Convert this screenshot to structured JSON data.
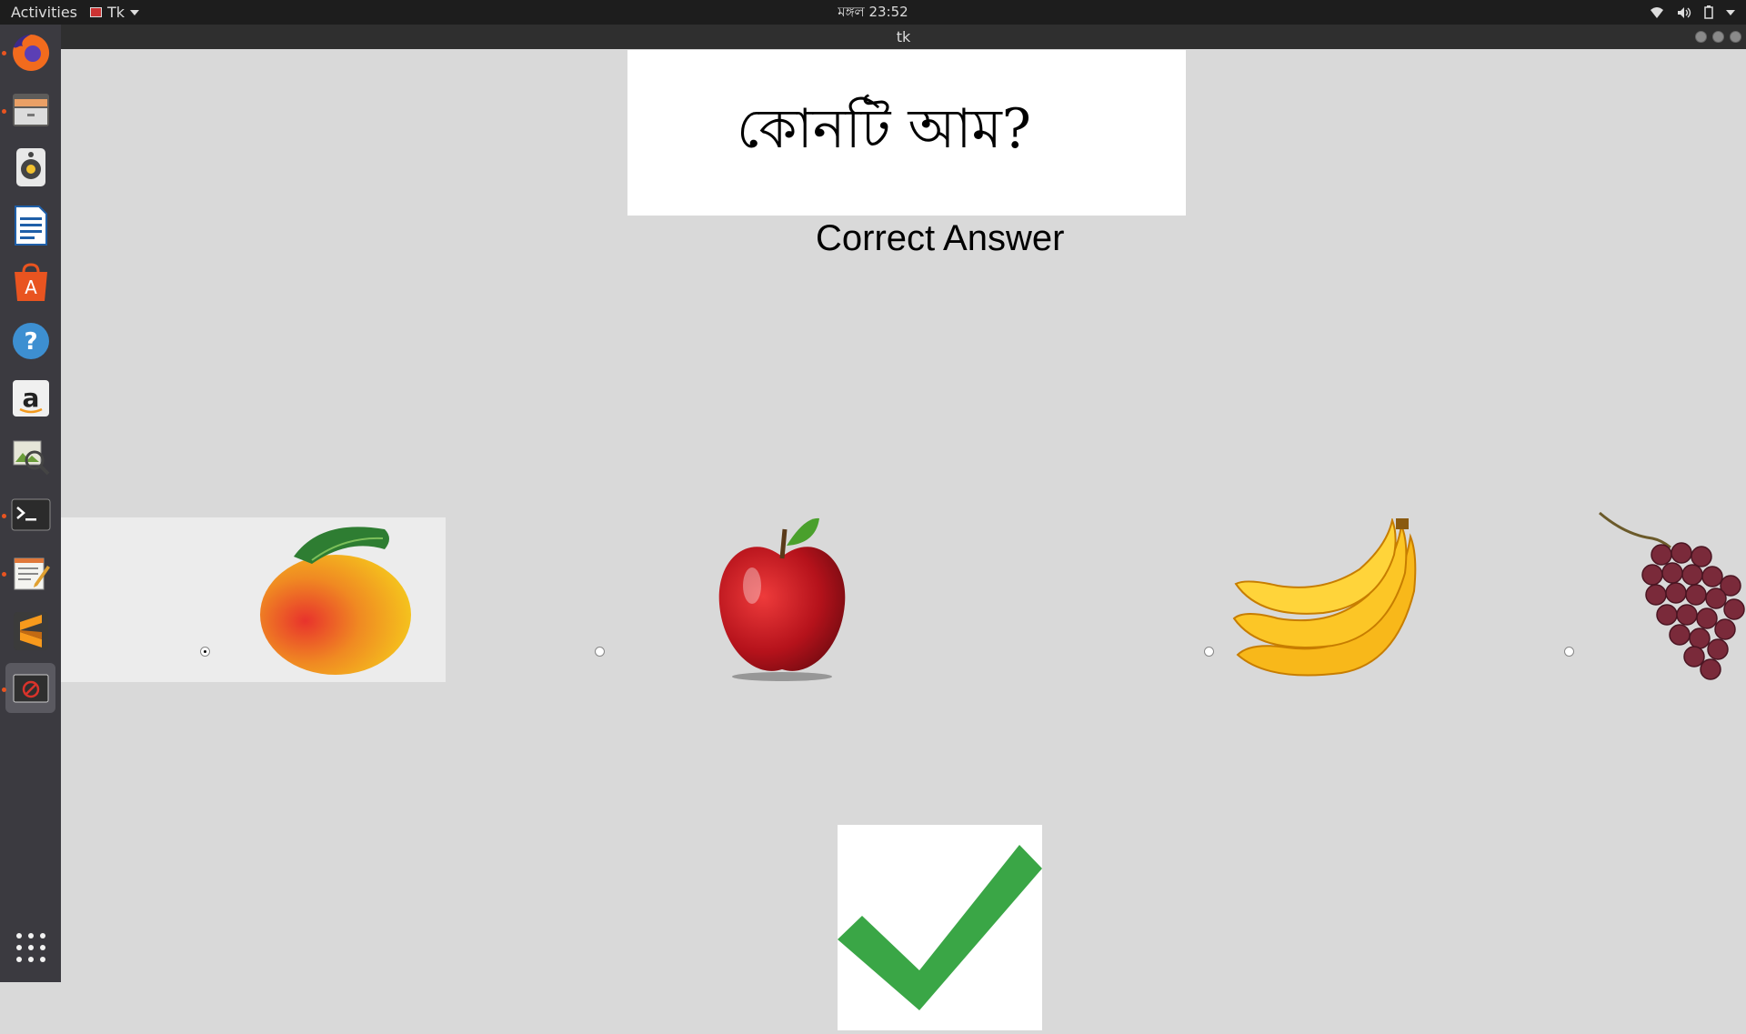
{
  "topbar": {
    "activities": "Activities",
    "app_menu": "Tk",
    "clock": "মঙ্গল 23:52"
  },
  "window": {
    "title": "tk"
  },
  "dock": {
    "apps": [
      {
        "name": "Firefox",
        "icon": "firefox-icon",
        "running": true
      },
      {
        "name": "Files",
        "icon": "files-icon",
        "running": true
      },
      {
        "name": "Rhythmbox",
        "icon": "rhythmbox-icon",
        "running": false
      },
      {
        "name": "LibreOffice Writer",
        "icon": "writer-icon",
        "running": false
      },
      {
        "name": "Ubuntu Software",
        "icon": "software-center-icon",
        "running": false
      },
      {
        "name": "Help",
        "icon": "help-icon",
        "running": false
      },
      {
        "name": "Amazon",
        "icon": "amazon-icon",
        "running": false
      },
      {
        "name": "Image Viewer",
        "icon": "image-viewer-icon",
        "running": false
      },
      {
        "name": "Terminal",
        "icon": "terminal-icon",
        "running": true
      },
      {
        "name": "Text Editor",
        "icon": "text-editor-icon",
        "running": true
      },
      {
        "name": "Sublime Text",
        "icon": "sublime-text-icon",
        "running": false
      },
      {
        "name": "Tk",
        "icon": "tk-app-icon",
        "running": true,
        "active": true
      }
    ],
    "show_apps_icon": "app-grid-icon"
  },
  "quiz": {
    "question": "কোনটি আম?",
    "feedback": "Correct Answer",
    "options": [
      {
        "fruit": "mango",
        "selected": true
      },
      {
        "fruit": "apple",
        "selected": false
      },
      {
        "fruit": "banana",
        "selected": false
      },
      {
        "fruit": "grapes",
        "selected": false
      }
    ],
    "result_icon": "checkmark-icon",
    "colors": {
      "check": "#3aa646",
      "apple": "#c8141b",
      "mango": "#f2a51c",
      "banana": "#f5c518",
      "grape": "#7a2a3a"
    }
  }
}
